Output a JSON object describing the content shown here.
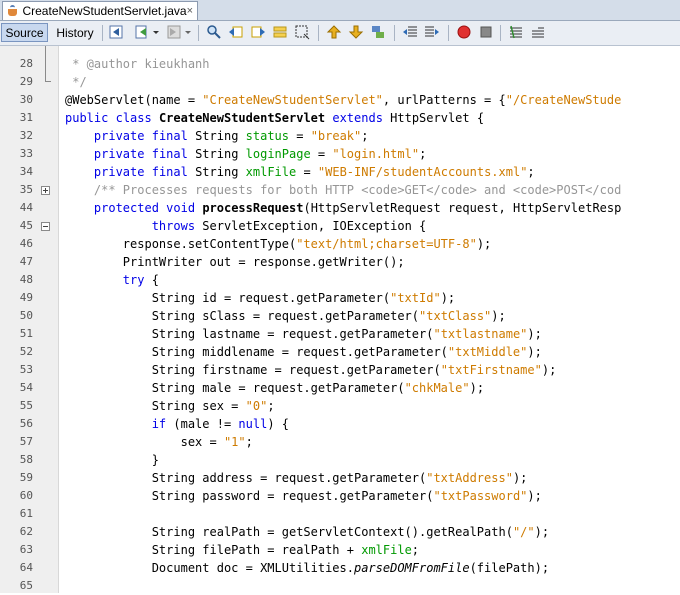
{
  "tab": {
    "filename": "CreateNewStudentServlet.java",
    "close": "×"
  },
  "toolbar": {
    "source_label": "Source",
    "history_label": "History",
    "icons": [
      "last-edit-icon",
      "back-icon",
      "forward-icon",
      "find-icon",
      "find-prev-icon",
      "find-next-icon",
      "toggle-highlight-icon",
      "toggle-rect-select-icon",
      "prev-bookmark-icon",
      "next-bookmark-icon",
      "toggle-bookmark-icon",
      "shift-left-icon",
      "shift-right-icon",
      "start-macro-icon",
      "stop-macro-icon",
      "comment-icon",
      "uncomment-icon"
    ]
  },
  "code": {
    "lines": [
      {
        "n": "28",
        "t": " * @author kieukhanh"
      },
      {
        "n": "29",
        "t": " */"
      },
      {
        "n": "30",
        "t": "@WebServlet(name = \"CreateNewStudentServlet\", urlPatterns = {\"/CreateNewStude"
      },
      {
        "n": "31",
        "t": "public class CreateNewStudentServlet extends HttpServlet {"
      },
      {
        "n": "32",
        "t": "    private final String status = \"break\";"
      },
      {
        "n": "33",
        "t": "    private final String loginPage = \"login.html\";"
      },
      {
        "n": "34",
        "t": "    private final String xmlFile = \"WEB-INF/studentAccounts.xml\";"
      },
      {
        "n": "35",
        "t": "    /** Processes requests for both HTTP <code>GET</code> and <code>POST</cod"
      },
      {
        "n": "44",
        "t": "    protected void processRequest(HttpServletRequest request, HttpServletResp"
      },
      {
        "n": "45",
        "t": "            throws ServletException, IOException {"
      },
      {
        "n": "46",
        "t": "        response.setContentType(\"text/html;charset=UTF-8\");"
      },
      {
        "n": "47",
        "t": "        PrintWriter out = response.getWriter();"
      },
      {
        "n": "48",
        "t": "        try {"
      },
      {
        "n": "49",
        "t": "            String id = request.getParameter(\"txtId\");"
      },
      {
        "n": "50",
        "t": "            String sClass = request.getParameter(\"txtClass\");"
      },
      {
        "n": "51",
        "t": "            String lastname = request.getParameter(\"txtlastname\");"
      },
      {
        "n": "52",
        "t": "            String middlename = request.getParameter(\"txtMiddle\");"
      },
      {
        "n": "53",
        "t": "            String firstname = request.getParameter(\"txtFirstname\");"
      },
      {
        "n": "54",
        "t": "            String male = request.getParameter(\"chkMale\");"
      },
      {
        "n": "55",
        "t": "            String sex = \"0\";"
      },
      {
        "n": "56",
        "t": "            if (male != null) {"
      },
      {
        "n": "57",
        "t": "                sex = \"1\";"
      },
      {
        "n": "58",
        "t": "            }"
      },
      {
        "n": "59",
        "t": "            String address = request.getParameter(\"txtAddress\");"
      },
      {
        "n": "60",
        "t": "            String password = request.getParameter(\"txtPassword\");"
      },
      {
        "n": "61",
        "t": ""
      },
      {
        "n": "62",
        "t": "            String realPath = getServletContext().getRealPath(\"/\");"
      },
      {
        "n": "63",
        "t": "            String filePath = realPath + xmlFile;"
      },
      {
        "n": "64",
        "t": "            Document doc = XMLUtilities.parseDOMFromFile(filePath);"
      },
      {
        "n": "65",
        "t": ""
      }
    ]
  },
  "colors": {
    "keyword": "#0000e6",
    "string": "#ce7b00",
    "field": "#009900",
    "comment": "#969696"
  }
}
